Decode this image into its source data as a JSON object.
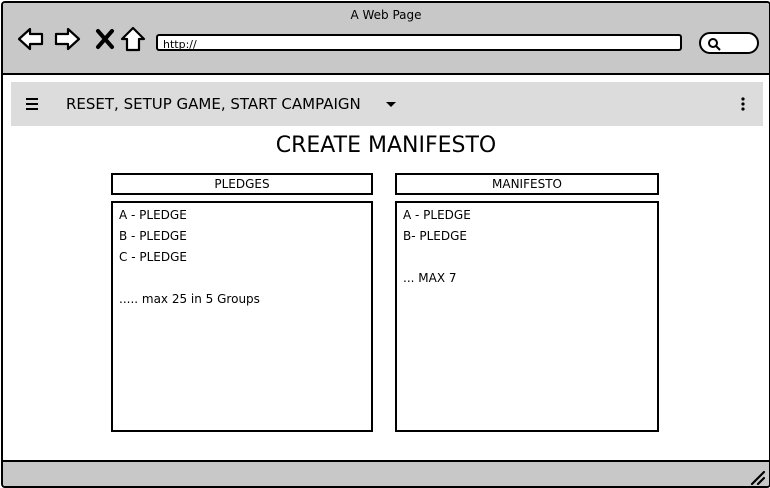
{
  "window": {
    "title": "A Web Page"
  },
  "address_bar": {
    "value": "http://"
  },
  "menubar": {
    "label": "RESET, SETUP GAME, START CAMPAIGN"
  },
  "page": {
    "title": "CREATE MANIFESTO"
  },
  "pledges": {
    "header": "PLEDGES",
    "items": [
      "A - PLEDGE",
      "B - PLEDGE",
      "C - PLEDGE",
      "",
      "..... max 25  in 5 Groups"
    ]
  },
  "manifesto": {
    "header": "MANIFESTO",
    "items": [
      "A - PLEDGE",
      "B- PLEDGE",
      "",
      "...  MAX 7"
    ]
  }
}
